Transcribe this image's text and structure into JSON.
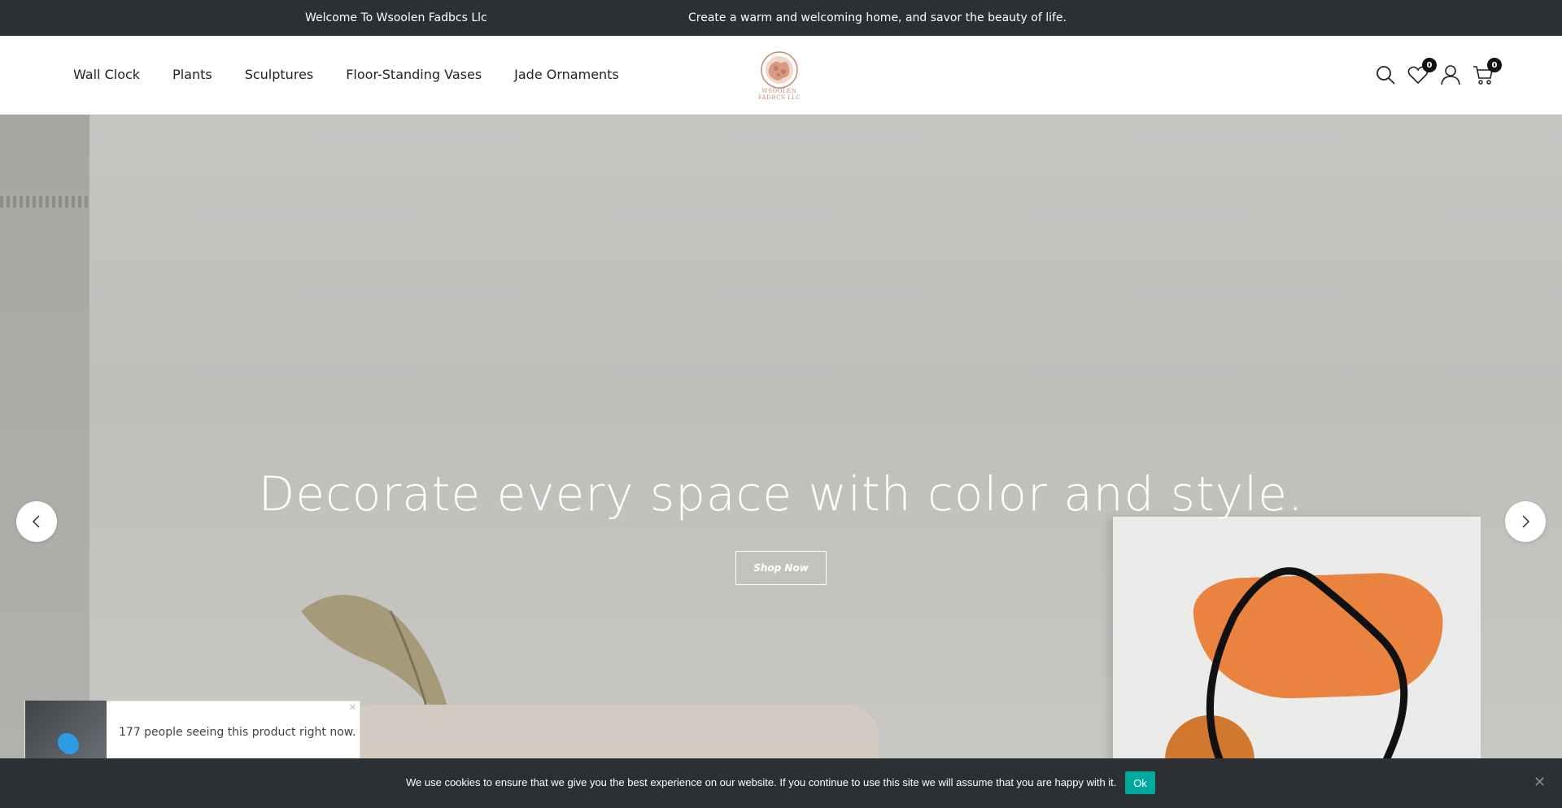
{
  "topbar": {
    "welcome": "Welcome To Wsoolen Fadbcs Llc",
    "promo": "Create a warm and welcoming home, and savor the beauty of life."
  },
  "header": {
    "nav": [
      "Wall Clock",
      "Plants",
      "Sculptures",
      "Floor-Standing Vases",
      "Jade Ornaments"
    ],
    "logo_text": "WSOOLEN FADBCS LLC",
    "wishlist_count": "0",
    "cart_count": "0"
  },
  "hero": {
    "title": "Decorate every space with color and style.",
    "button": "Shop Now"
  },
  "proof": {
    "text": "177 people seeing this product right now."
  },
  "cookie": {
    "message": "We use cookies to ensure that we give you the best experience on our website. If you continue to use this site we will assume that you are happy with it.",
    "ok": "Ok"
  },
  "icons": [
    "search-icon",
    "heart-icon",
    "user-icon",
    "cart-icon",
    "chevron-left-icon",
    "chevron-right-icon",
    "close-icon"
  ],
  "colors": {
    "topbar": "#2b3035",
    "cookie_ok": "#00a99d",
    "accent_logo": "#c78c74"
  }
}
